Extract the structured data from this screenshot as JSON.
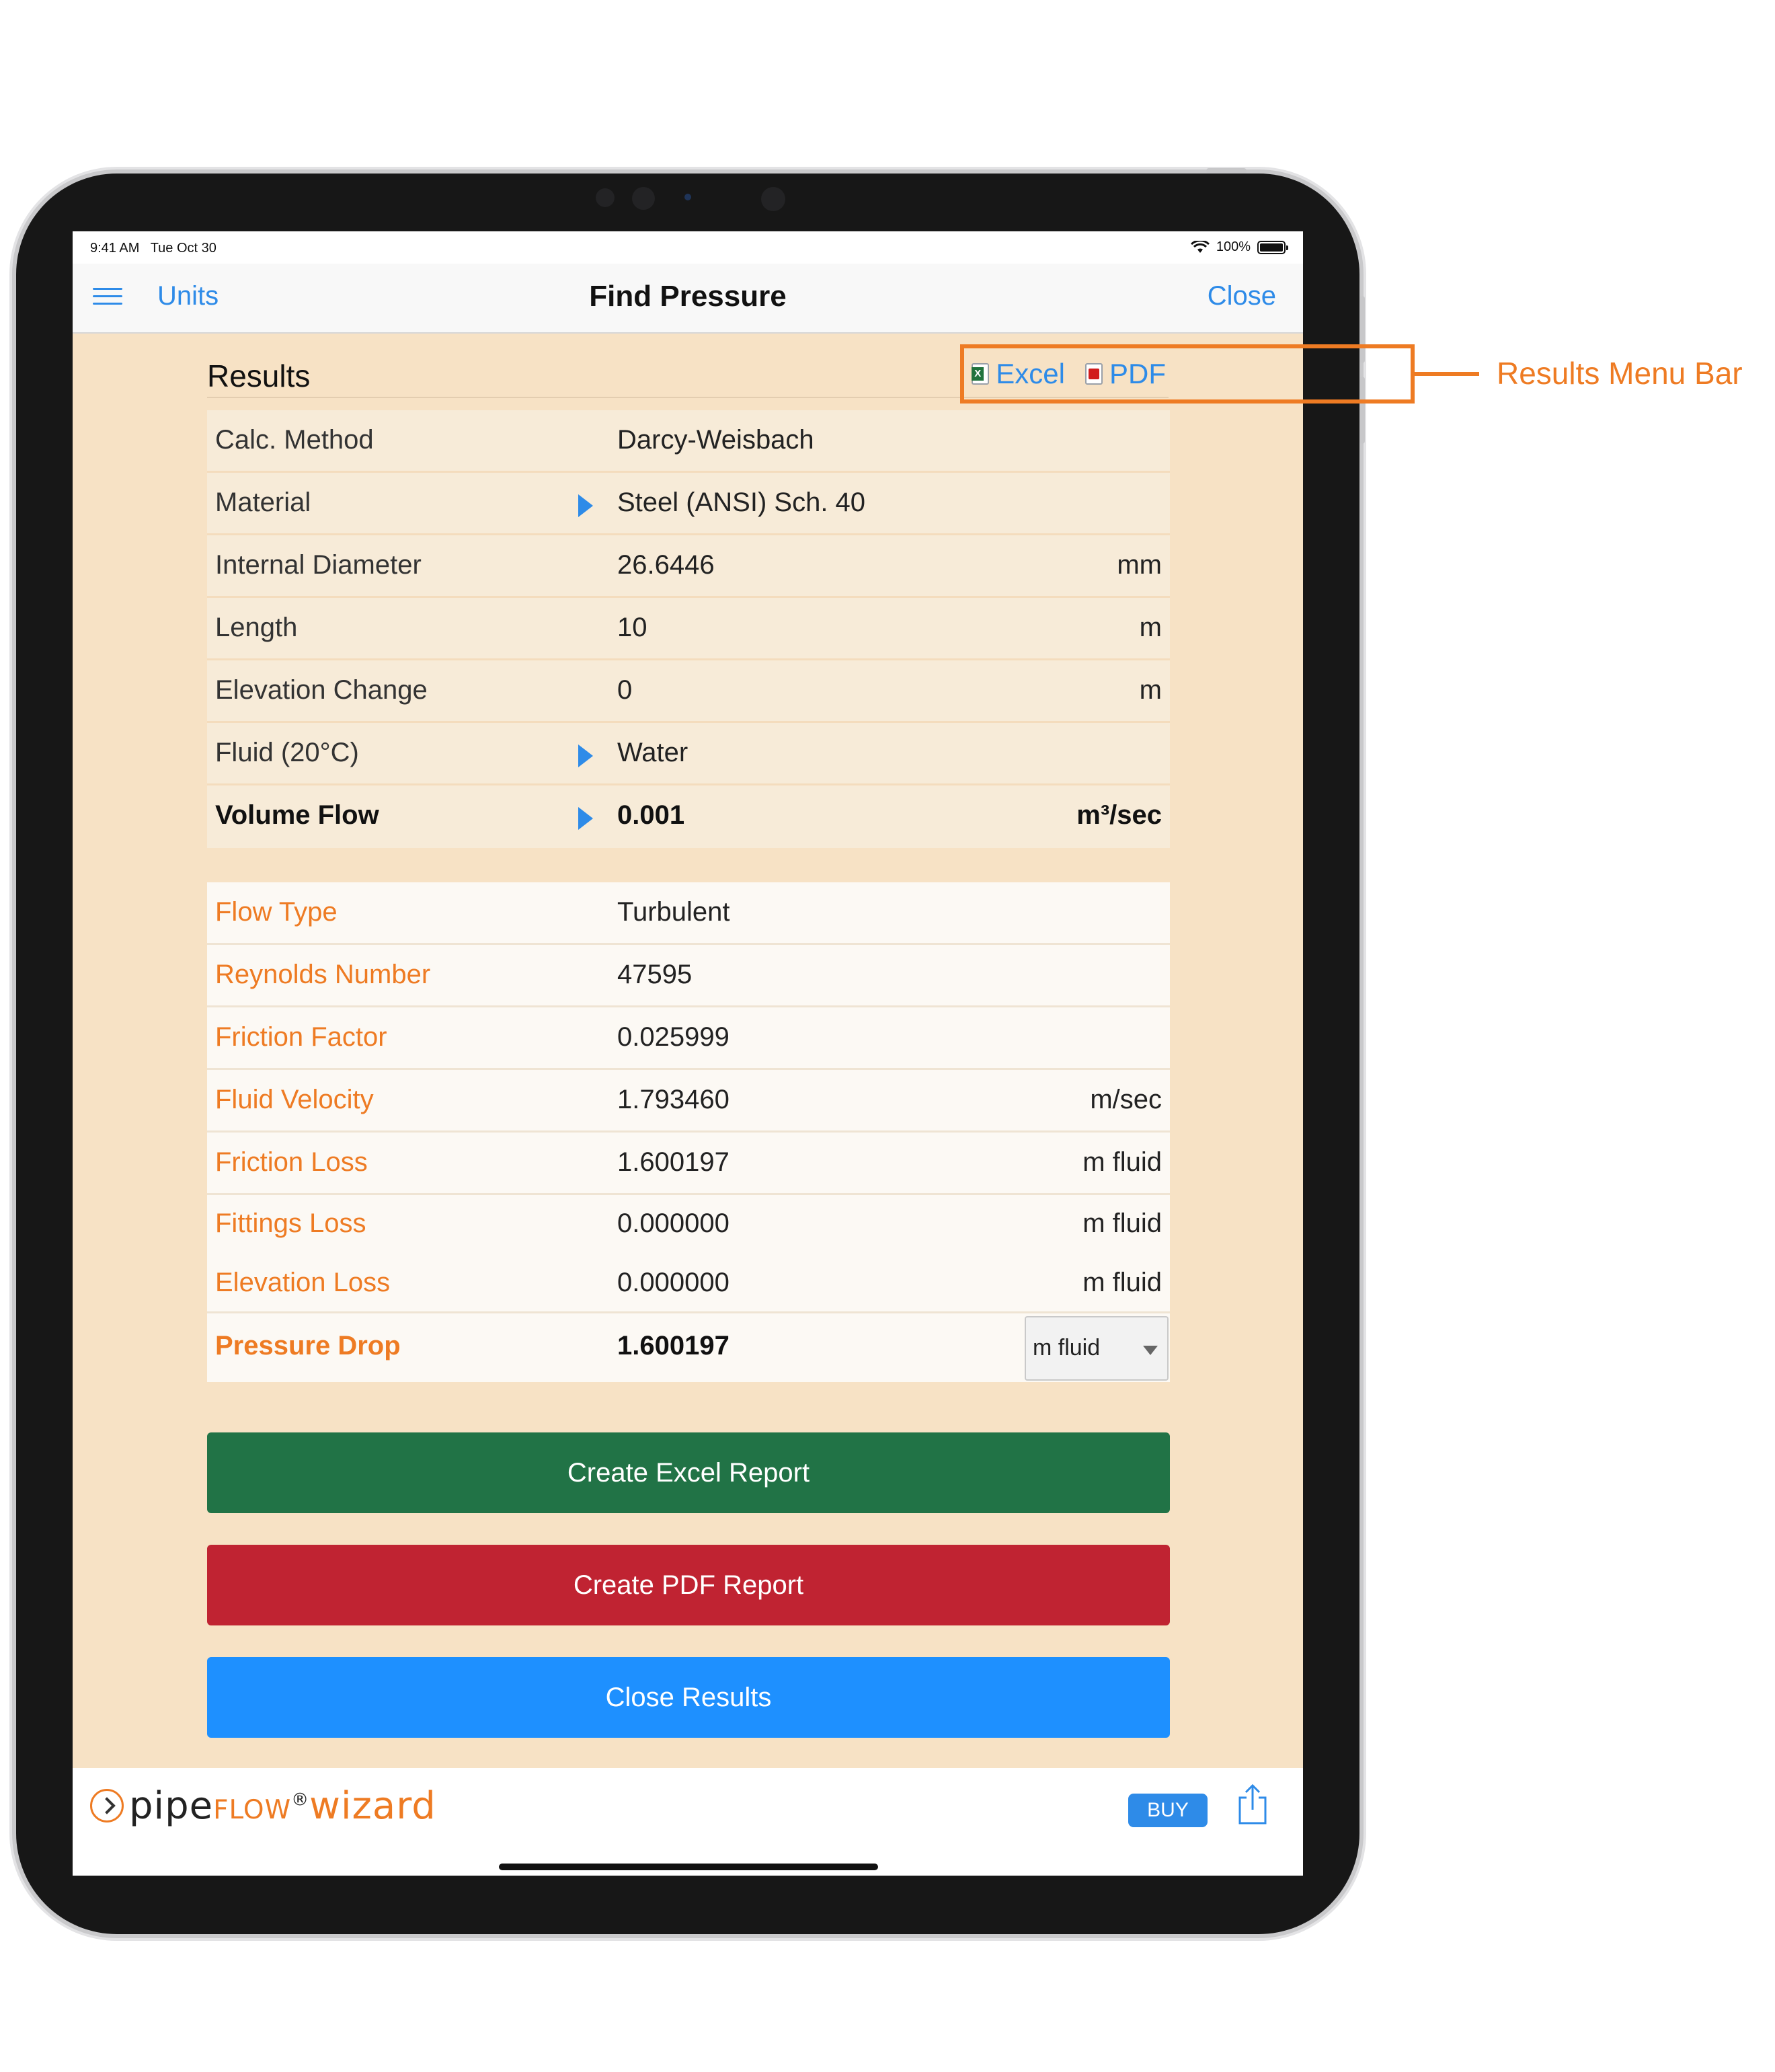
{
  "status_bar": {
    "time": "9:41 AM",
    "date": "Tue Oct 30",
    "battery": "100%"
  },
  "nav": {
    "menu_icon": "hamburger-icon",
    "left_link": "Units",
    "title": "Find Pressure",
    "right_link": "Close"
  },
  "results": {
    "title": "Results",
    "excel_link": "Excel",
    "pdf_link": "PDF"
  },
  "inputs": [
    {
      "label": "Calc. Method",
      "value": "Darcy-Weisbach",
      "unit": "",
      "has_arrow": false,
      "bold": false
    },
    {
      "label": "Material",
      "value": "Steel (ANSI) Sch.  40",
      "unit": "",
      "has_arrow": true,
      "bold": false
    },
    {
      "label": "Internal Diameter",
      "value": "26.6446",
      "unit": "mm",
      "has_arrow": false,
      "bold": false
    },
    {
      "label": "Length",
      "value": "10",
      "unit": "m",
      "has_arrow": false,
      "bold": false
    },
    {
      "label": "Elevation Change",
      "value": "0",
      "unit": "m",
      "has_arrow": false,
      "bold": false
    },
    {
      "label": "Fluid (20°C)",
      "value": "Water",
      "unit": "",
      "has_arrow": true,
      "bold": false
    },
    {
      "label": "Volume Flow",
      "value": "0.001",
      "unit": "m³/sec",
      "has_arrow": true,
      "bold": true
    }
  ],
  "outputs": [
    {
      "label": "Flow Type",
      "value": "Turbulent",
      "unit": ""
    },
    {
      "label": "Reynolds Number",
      "value": "47595",
      "unit": ""
    },
    {
      "label": "Friction Factor",
      "value": "0.025999",
      "unit": ""
    },
    {
      "label": "Fluid Velocity",
      "value": "1.793460",
      "unit": "m/sec"
    },
    {
      "label": "Friction Loss",
      "value": "1.600197",
      "unit": "m fluid"
    },
    {
      "label": "Fittings Loss",
      "value": "0.000000",
      "unit": "m fluid"
    },
    {
      "label": "Elevation Loss",
      "value": "0.000000",
      "unit": "m fluid"
    }
  ],
  "pressure_drop": {
    "label": "Pressure Drop",
    "value": "1.600197",
    "unit_selected": "m fluid"
  },
  "buttons": {
    "excel_report": "Create Excel Report",
    "pdf_report": "Create PDF Report",
    "close_results": "Close Results"
  },
  "colors": {
    "excel_green": "#217346",
    "pdf_red": "#c02332",
    "close_blue": "#1e90ff",
    "accent_orange": "#ee7b23",
    "link_blue": "#2e8be8"
  },
  "footer": {
    "logo_part1": "pipe",
    "logo_part2": "flow",
    "logo_reg": "®",
    "logo_part3": "wizard",
    "buy_label": "BUY",
    "share_icon": "share-icon"
  },
  "annotation": {
    "label": "Results Menu Bar"
  }
}
